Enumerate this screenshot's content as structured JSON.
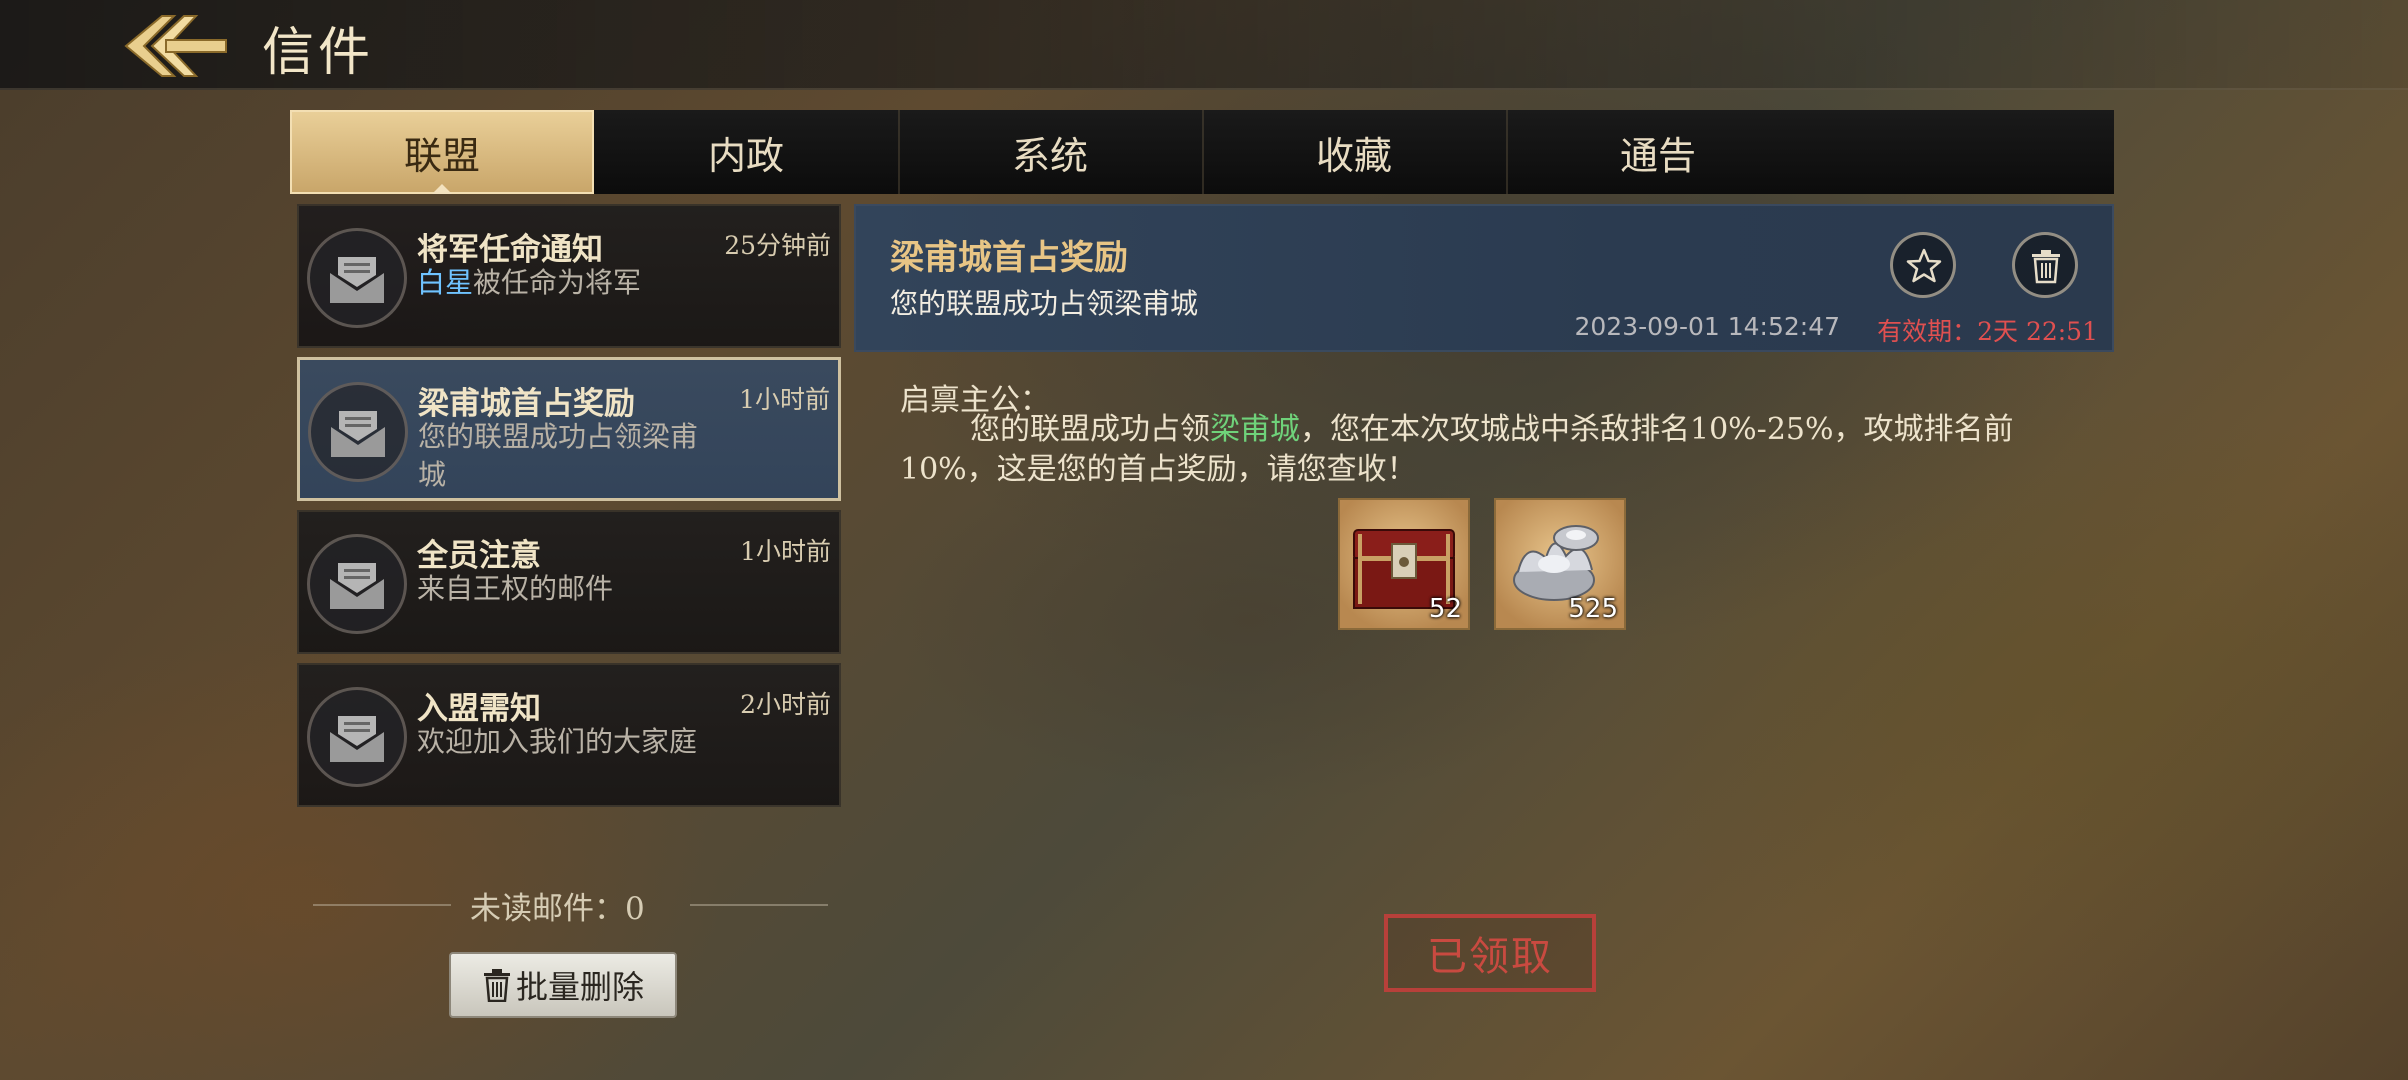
{
  "header": {
    "title": "信件"
  },
  "tabs": [
    {
      "label": "联盟"
    },
    {
      "label": "内政"
    },
    {
      "label": "系统"
    },
    {
      "label": "收藏"
    },
    {
      "label": "通告"
    }
  ],
  "mails": [
    {
      "title": "将军任命通知",
      "time": "25分钟前",
      "highlight": "白星",
      "preview": "被任命为将军"
    },
    {
      "title": "梁甫城首占奖励",
      "time": "1小时前",
      "preview": "您的联盟成功占领梁甫城"
    },
    {
      "title": "全员注意",
      "time": "1小时前",
      "preview": "来自王权的邮件"
    },
    {
      "title": "入盟需知",
      "time": "2小时前",
      "preview": "欢迎加入我们的大家庭"
    }
  ],
  "list_footer": {
    "unread": "未读邮件：0",
    "bulk_delete": "批量删除"
  },
  "detail": {
    "title": "梁甫城首占奖励",
    "subtitle": "您的联盟成功占领梁甫城",
    "date": "2023-09-01 14:52:47",
    "expiry": "有效期：2天 22:51",
    "greeting": "启禀主公：",
    "body_pre": "您的联盟成功占领",
    "body_place": "梁甫城",
    "body_post": "，您在本次攻城战中杀敌排名10%-25%，攻城排名前10%，这是您的首占奖励，请您查收！",
    "rewards": [
      {
        "icon": "treasure-chest-icon",
        "qty": "52"
      },
      {
        "icon": "silver-ingot-icon",
        "qty": "525"
      }
    ],
    "status": "已领取"
  }
}
